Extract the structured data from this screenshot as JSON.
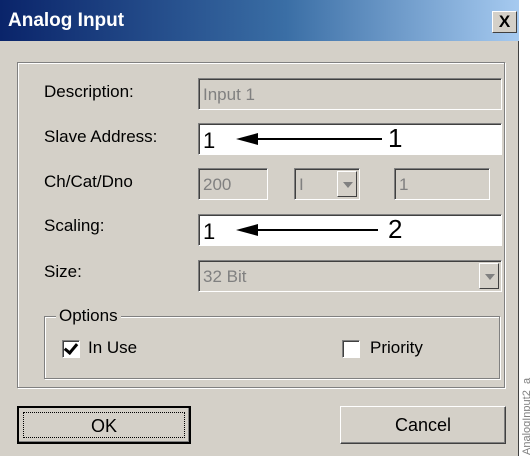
{
  "window": {
    "title": "Analog Input",
    "close_label": "X"
  },
  "form": {
    "description": {
      "label": "Description:",
      "value": "Input 1"
    },
    "slave_address": {
      "label": "Slave Address:",
      "value": "1"
    },
    "ch_cat_dno": {
      "label": "Ch/Cat/Dno",
      "channel": "200",
      "category": "I",
      "dno": "1"
    },
    "scaling": {
      "label": "Scaling:",
      "value": "1"
    },
    "size": {
      "label": "Size:",
      "value": "32 Bit"
    }
  },
  "annotations": {
    "slave_address_callout": "1",
    "scaling_callout": "2"
  },
  "options": {
    "legend": "Options",
    "in_use": {
      "label": "In Use",
      "checked": true
    },
    "priority": {
      "label": "Priority",
      "checked": false
    }
  },
  "buttons": {
    "ok": "OK",
    "cancel": "Cancel"
  },
  "side_caption": "AnalogInput2_a"
}
